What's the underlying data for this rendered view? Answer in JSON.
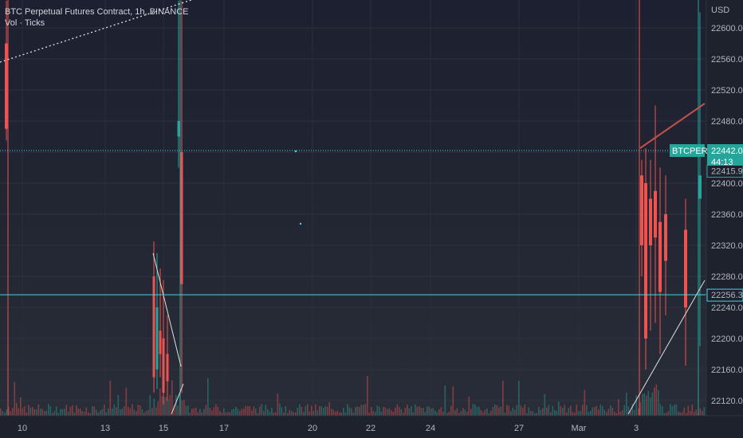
{
  "header": {
    "title": "BTC Perpetual Futures Contract, 1h, BINANCE",
    "indicator": "Vol · Ticks"
  },
  "colors": {
    "up": "#26a69a",
    "down": "#ef5350",
    "hline": "#4dd0e1",
    "tag": "#26a69a",
    "trend_red": "#c0504d",
    "trend_white": "#e0e0e0"
  },
  "chart_data": {
    "type": "candlestick",
    "currency": "USD",
    "symbol_tag": "BTCPERP",
    "last_price": "22442.0",
    "countdown": "44:13",
    "secondary_price": "22415.9",
    "hline_price": "22256.3",
    "y_ticks": [
      22600,
      22560,
      22520,
      22480,
      22440,
      22400,
      22360,
      22320,
      22280,
      22240,
      22200,
      22160,
      22120
    ],
    "y_tick_labels": [
      "22600.0",
      "22560.0",
      "22520.0",
      "22480.0",
      "22440.0",
      "22400.0",
      "22360.0",
      "22320.0",
      "22280.0",
      "22240.0",
      "22200.0",
      "22160.0",
      "22120.0"
    ],
    "x_ticks": [
      "10",
      "13",
      "15",
      "17",
      "20",
      "22",
      "24",
      "27",
      "Mar",
      "3"
    ],
    "candles": [
      {
        "o": 22580,
        "h": 22635,
        "c": 22470,
        "l": 22455
      },
      {
        "o": 22280,
        "h": 22325,
        "c": 22150,
        "l": 22130
      },
      {
        "o": 22160,
        "h": 22310,
        "c": 22240,
        "l": 22135
      },
      {
        "o": 22210,
        "h": 22290,
        "c": 22180,
        "l": 22150
      },
      {
        "o": 22200,
        "h": 22275,
        "c": 22130,
        "l": 22115
      },
      {
        "o": 22180,
        "h": 22230,
        "c": 22145,
        "l": 22120
      },
      {
        "o": 22460,
        "h": 22635,
        "c": 22480,
        "l": 22420
      },
      {
        "o": 22440,
        "h": 22635,
        "c": 22270,
        "l": 22130
      },
      {
        "o": 22410,
        "h": 22430,
        "c": 22320,
        "l": 22280
      },
      {
        "o": 22400,
        "h": 22445,
        "c": 22200,
        "l": 22160
      },
      {
        "o": 22380,
        "h": 22430,
        "c": 22320,
        "l": 22210
      },
      {
        "o": 22390,
        "h": 22500,
        "c": 22330,
        "l": 22220
      },
      {
        "o": 22350,
        "h": 22420,
        "c": 22260,
        "l": 22180
      },
      {
        "o": 22360,
        "h": 22410,
        "c": 22300,
        "l": 22230
      },
      {
        "o": 22340,
        "h": 22380,
        "c": 22240,
        "l": 22165
      },
      {
        "o": 22380,
        "h": 22620,
        "c": 22410,
        "l": 22190
      }
    ]
  }
}
